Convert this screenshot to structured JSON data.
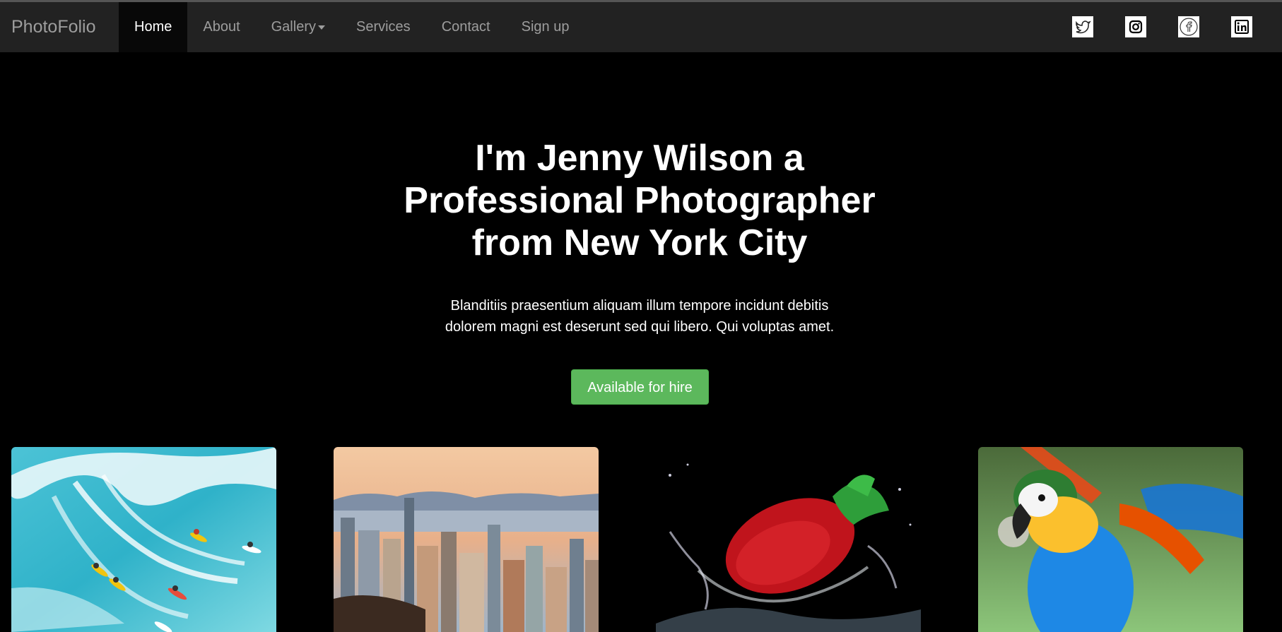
{
  "nav": {
    "brand": "PhotoFolio",
    "items": [
      {
        "label": "Home",
        "active": true
      },
      {
        "label": "About"
      },
      {
        "label": "Gallery",
        "has_dropdown": true
      },
      {
        "label": "Services"
      },
      {
        "label": "Contact"
      },
      {
        "label": "Sign up"
      }
    ],
    "social": [
      "twitter-icon",
      "instagram-icon",
      "facebook-icon",
      "linkedin-icon"
    ]
  },
  "hero": {
    "title_lines": [
      "I'm Jenny Wilson a",
      "Professional Photographer",
      "from New York City"
    ],
    "text_lines": [
      "Blanditiis praesentium aliquam illum tempore incidunt debitis",
      "dolorem magni est deserunt sed qui libero. Qui voluptas amet."
    ],
    "cta": "Available for hire"
  },
  "gallery": [
    "surfers-photo",
    "city-skyline-photo",
    "strawberry-splash-photo",
    "parrot-photo"
  ],
  "colors": {
    "navbar": "#222222",
    "active_nav": "#080808",
    "nav_text": "#9d9d9d",
    "background": "#000000",
    "cta": "#5cb85c"
  }
}
